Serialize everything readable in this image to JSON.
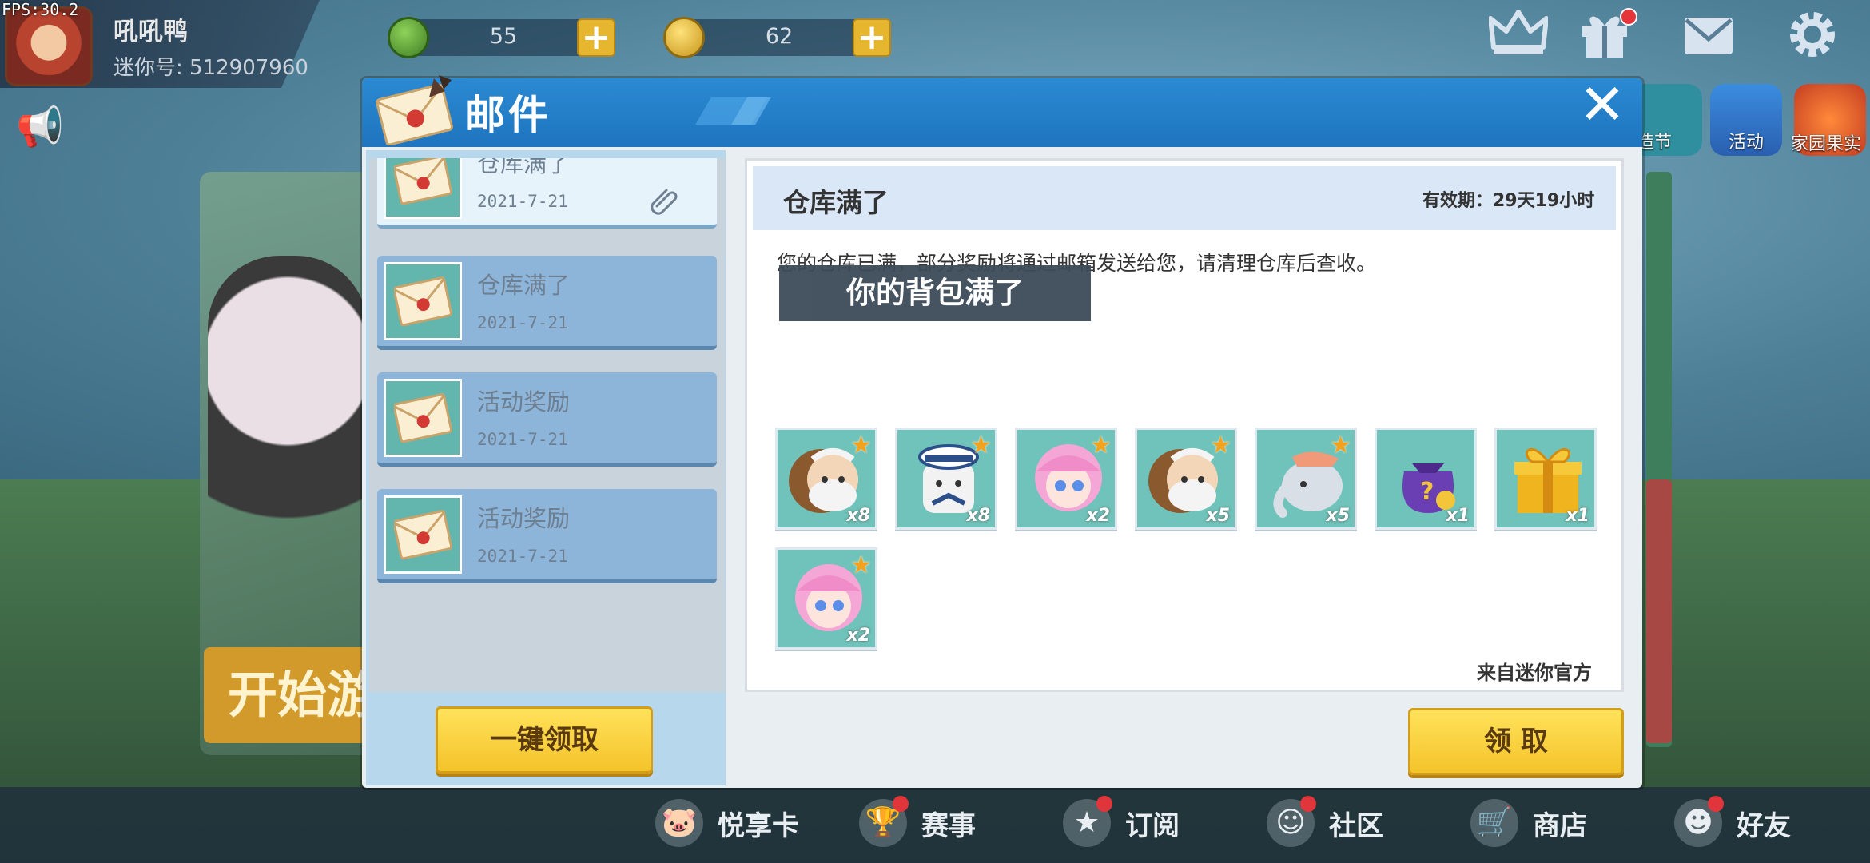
{
  "fps": "FPS:30.2",
  "profile": {
    "nickname": "吼吼鸭",
    "user_id": "迷你号: 512907960"
  },
  "currency": [
    {
      "name": "green-coin",
      "value": "55",
      "color": "#4b8b2e"
    },
    {
      "name": "gold-coin",
      "value": "62",
      "color": "#d7a91f"
    }
  ],
  "plus": "+",
  "top_icons": [
    "crown-icon",
    "gift-icon",
    "mail-icon",
    "gear-icon"
  ],
  "side_labels": {
    "festival": "造节",
    "activity": "活动",
    "fruit": "家园果实"
  },
  "background": {
    "start_button": "开始游"
  },
  "dialog": {
    "title": "邮件",
    "close": "✕",
    "claim_all": "一键领取",
    "claim": "领 取",
    "mails": [
      {
        "title": "仓库满了",
        "date": "2021-7-21",
        "selected": true,
        "has_attachment": true
      },
      {
        "title": "仓库满了",
        "date": "2021-7-21",
        "selected": false
      },
      {
        "title": "活动奖励",
        "date": "2021-7-21",
        "selected": false
      },
      {
        "title": "活动奖励",
        "date": "2021-7-21",
        "selected": false
      }
    ],
    "detail": {
      "subject": "仓库满了",
      "expire": "有效期：29天19小时",
      "body": "您的仓库已满，部分奖励将通过邮箱发送给您，请清理仓库后查收。",
      "caption_overlay": "你的背包满了",
      "from": "来自迷你官方",
      "rewards": [
        {
          "icon": "old-man-avatar-icon",
          "qty": "x8",
          "star": true
        },
        {
          "icon": "sailor-bear-avatar-icon",
          "qty": "x8",
          "star": true
        },
        {
          "icon": "pink-girl-avatar-icon",
          "qty": "x2",
          "star": true
        },
        {
          "icon": "old-man-avatar-icon",
          "qty": "x5",
          "star": true
        },
        {
          "icon": "elephant-avatar-icon",
          "qty": "x5",
          "star": true
        },
        {
          "icon": "mystery-bag-icon",
          "qty": "x1",
          "star": false
        },
        {
          "icon": "gift-box-icon",
          "qty": "x1",
          "star": false
        },
        {
          "icon": "pink-girl-avatar-icon",
          "qty": "x2",
          "star": true
        }
      ]
    }
  },
  "bottom_nav": [
    {
      "label": "悦享卡",
      "icon": "pig-icon",
      "dot": false
    },
    {
      "label": "赛事",
      "icon": "trophy-icon",
      "dot": true
    },
    {
      "label": "订阅",
      "icon": "star-badge-icon",
      "dot": true
    },
    {
      "label": "社区",
      "icon": "community-icon",
      "dot": true
    },
    {
      "label": "商店",
      "icon": "cart-icon",
      "dot": false
    },
    {
      "label": "好友",
      "icon": "friend-icon",
      "dot": true
    }
  ]
}
